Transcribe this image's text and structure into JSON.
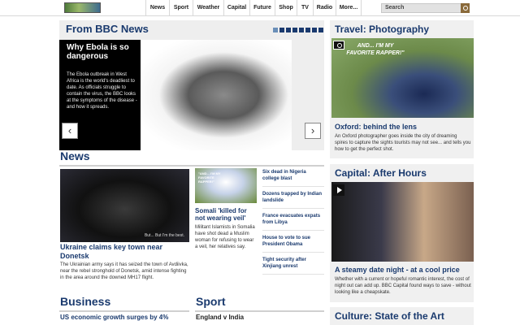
{
  "nav": {
    "items": [
      {
        "label": "News"
      },
      {
        "label": "Sport"
      },
      {
        "label": "Weather"
      },
      {
        "label": "Capital"
      },
      {
        "label": "Future"
      },
      {
        "label": "Shop"
      },
      {
        "label": "TV"
      },
      {
        "label": "Radio"
      },
      {
        "label": "More..."
      }
    ],
    "search_placeholder": "Search"
  },
  "from_bbc": {
    "title": "From BBC News",
    "feature_title": "Why Ebola is so dangerous",
    "feature_body": "The Ebola outbreak in West Africa is the world's deadliest to date. As officials struggle to contain the virus, the BBC looks at the symptoms of the disease - and how it spreads.",
    "prev_icon": "‹",
    "next_icon": "›"
  },
  "news": {
    "title": "News",
    "lead_image_caption": "But... But I'm the best.",
    "lead_title": "Ukraine claims key town near Donetsk",
    "lead_body": "The Ukrainian army says it has seized the town of Avdiivka, near the rebel stronghold of Donetsk, amid intense fighting in the area around the downed MH17 flight.",
    "small_image_caption": "\"AND... I'M MY FAVORITE RAPPER!\"",
    "small_title": "Somali 'killed for not wearing veil'",
    "small_body": "Militant Islamists in Somalia have shot dead a Muslim woman for refusing to wear a veil, her relatives say.",
    "side_items": [
      "Six dead in Nigeria college blast",
      "Dozens trapped by Indian landslide",
      "France evacuates expats from Libya",
      "House to vote to sue President Obama",
      "Tight security after Xinjiang unrest"
    ]
  },
  "business": {
    "title": "Business",
    "item": "US economic growth surges by 4%"
  },
  "sport": {
    "title": "Sport",
    "item": "England v India"
  },
  "travel": {
    "title": "Travel: Photography",
    "image_caption": "AND... I'M MY FAVORITE RAPPER!\"",
    "item_title": "Oxford: behind the lens",
    "item_body": "An Oxford photographer goes inside the city of dreaming spires to capture the sights tourists may not see... and tells you how to get the perfect shot."
  },
  "capital": {
    "title": "Capital: After Hours",
    "item_title": "A steamy date night - at a cool price",
    "item_body": "Whether with a current or hopeful romantic interest, the cost of night out can add up. BBC Capital found ways to save - without looking like a cheapskate."
  },
  "culture": {
    "title": "Culture: State of the Art"
  }
}
